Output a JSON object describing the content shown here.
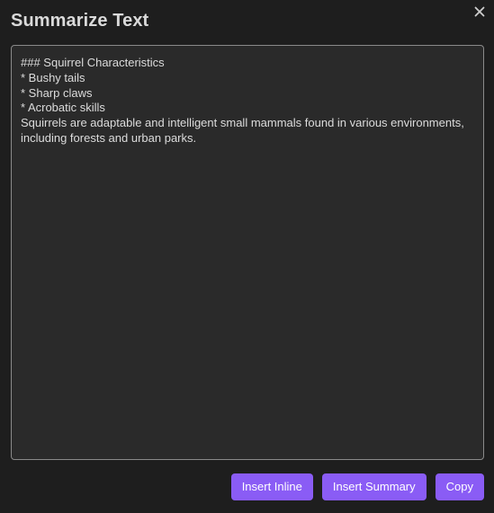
{
  "dialog": {
    "title": "Summarize Text",
    "close_icon": "close-icon"
  },
  "editor": {
    "value": "### Squirrel Characteristics\n* Bushy tails\n* Sharp claws\n* Acrobatic skills\nSquirrels are adaptable and intelligent small mammals found in various environments, including forests and urban parks."
  },
  "actions": {
    "insert_inline": "Insert Inline",
    "insert_summary": "Insert Summary",
    "copy": "Copy"
  },
  "colors": {
    "background": "#1e1e1e",
    "textarea_bg": "#2a2a2a",
    "accent": "#8a5cf5"
  }
}
